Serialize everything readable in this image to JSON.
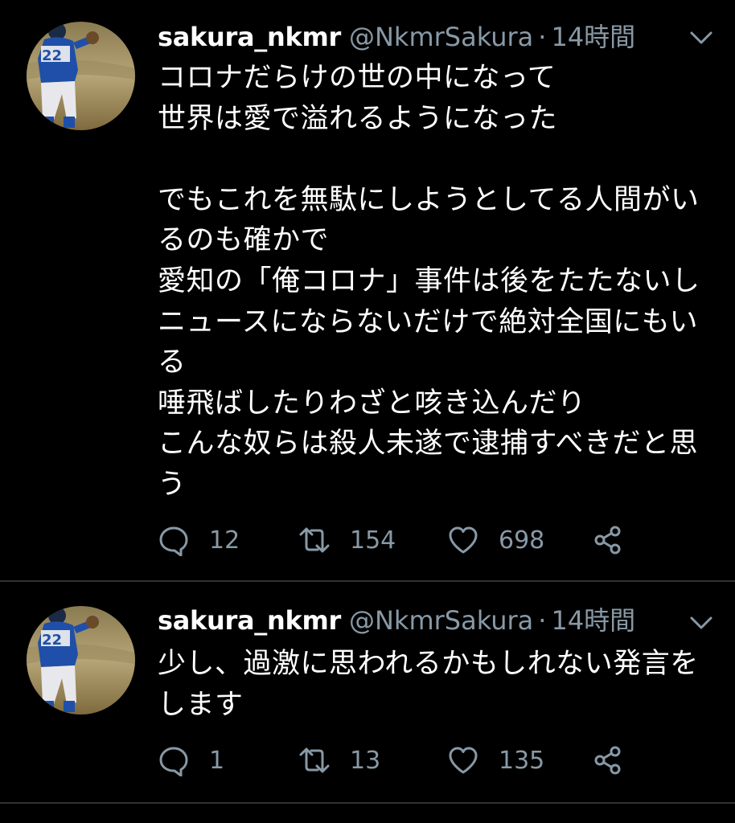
{
  "colors": {
    "background": "#000000",
    "text_primary": "#ffffff",
    "text_secondary": "#8899a6",
    "divider": "#2f3336"
  },
  "tweets": [
    {
      "display_name": "sakura_nkmr",
      "handle": "@NkmrSakura",
      "separator": "·",
      "time": "14時間",
      "text": "コロナだらけの世の中になって\n世界は愛で溢れるようになった\n\nでもこれを無駄にしようとしてる人間がいるのも確かで\n愛知の「俺コロナ」事件は後をたたないしニュースにならないだけで絶対全国にもいる\n唾飛ばしたりわざと咳き込んだり\nこんな奴らは殺人未遂で逮捕すべきだと思う",
      "replies": "12",
      "retweets": "154",
      "likes": "698",
      "icons": {
        "reply": "reply-icon",
        "retweet": "retweet-icon",
        "like": "heart-icon",
        "share": "share-icon",
        "menu": "chevron-down-icon"
      }
    },
    {
      "display_name": "sakura_nkmr",
      "handle": "@NkmrSakura",
      "separator": "·",
      "time": "14時間",
      "text": "少し、過激に思われるかもしれない発言をします",
      "replies": "1",
      "retweets": "13",
      "likes": "135",
      "icons": {
        "reply": "reply-icon",
        "retweet": "retweet-icon",
        "like": "heart-icon",
        "share": "share-icon",
        "menu": "chevron-down-icon"
      }
    }
  ]
}
